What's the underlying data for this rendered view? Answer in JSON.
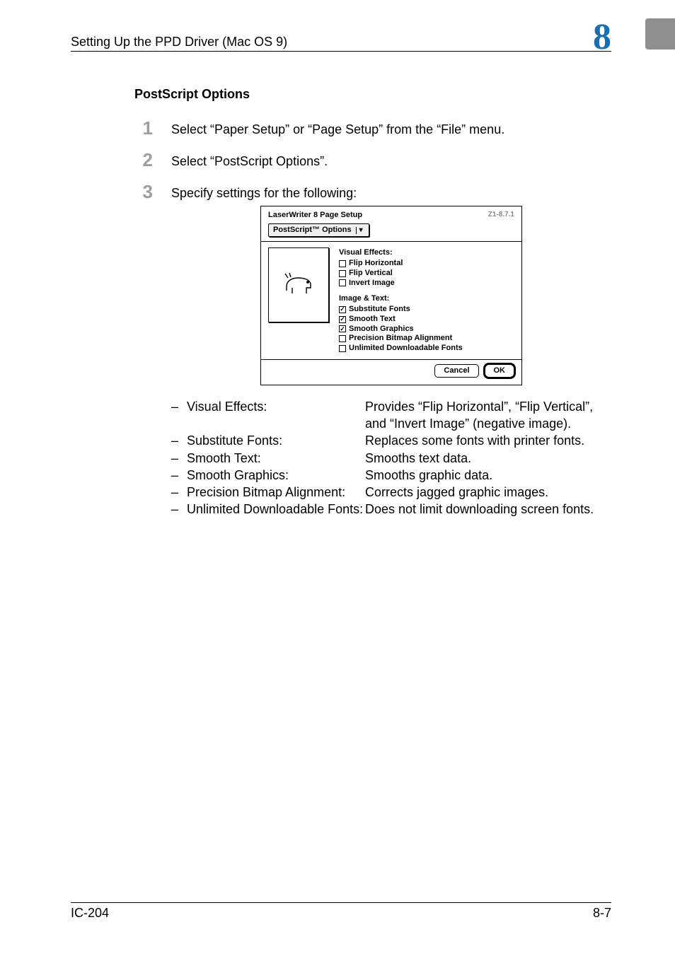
{
  "header": {
    "left": "Setting Up the PPD Driver (Mac OS 9)",
    "chapter": "8"
  },
  "section_title": "PostScript Options",
  "steps": [
    {
      "n": "1",
      "text": "Select “Paper Setup” or “Page Setup” from the “File” menu."
    },
    {
      "n": "2",
      "text": "Select “PostScript Options”."
    },
    {
      "n": "3",
      "text": "Specify settings for the following:"
    }
  ],
  "dialog": {
    "title": "LaserWriter 8 Page Setup",
    "version": "Z1-8.7.1",
    "popup": "PostScript™ Options",
    "group1_title": "Visual Effects:",
    "group1_items": [
      {
        "label": "Flip Horizontal",
        "checked": false
      },
      {
        "label": "Flip Vertical",
        "checked": false
      },
      {
        "label": "Invert Image",
        "checked": false
      }
    ],
    "group2_title": "Image & Text:",
    "group2_items": [
      {
        "label": "Substitute Fonts",
        "checked": true
      },
      {
        "label": "Smooth Text",
        "checked": true
      },
      {
        "label": "Smooth Graphics",
        "checked": true
      },
      {
        "label": "Precision Bitmap Alignment",
        "checked": false
      },
      {
        "label": "Unlimited Downloadable Fonts",
        "checked": false
      }
    ],
    "cancel": "Cancel",
    "ok": "OK"
  },
  "definitions": [
    {
      "term": "Visual Effects:",
      "desc": "Provides “Flip Horizontal”, “Flip Vertical”, and “Invert Image” (negative image)."
    },
    {
      "term": "Substitute Fonts:",
      "desc": "Replaces some fonts with printer fonts."
    },
    {
      "term": "Smooth Text:",
      "desc": "Smooths text data."
    },
    {
      "term": "Smooth Graphics:",
      "desc": "Smooths graphic data."
    },
    {
      "term": "Precision Bitmap Alignment:",
      "desc": "Corrects jagged graphic images."
    },
    {
      "term": "Unlimited Downloadable Fonts:",
      "desc": "Does not limit downloading screen fonts."
    }
  ],
  "footer": {
    "left": "IC-204",
    "right": "8-7"
  }
}
